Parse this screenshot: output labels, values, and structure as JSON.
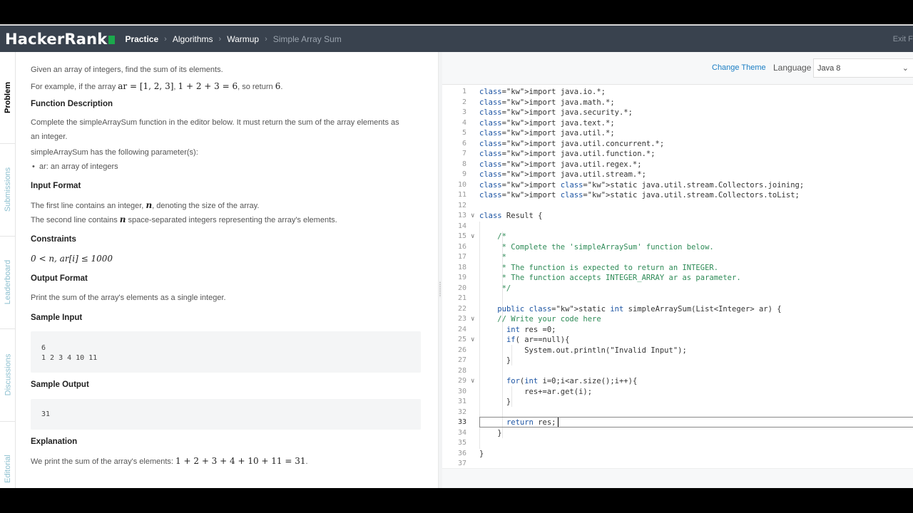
{
  "nav": {
    "logo": "HackerRank",
    "crumbs": [
      "Practice",
      "Algorithms",
      "Warmup",
      "Simple Array Sum"
    ],
    "exit": "Exit Fu"
  },
  "tabs": [
    "Problem",
    "Submissions",
    "Leaderboard",
    "Discussions",
    "Editorial"
  ],
  "problem": {
    "intro": "Given an array of integers, find the sum of its elements.",
    "example_prefix": "For example, if the array ",
    "example_math1": "ar = [1, 2, 3]",
    "example_mid": ", ",
    "example_math2": "1 + 2 + 3 = 6",
    "example_suffix": ", so return ",
    "example_math3": "6",
    "example_end": ".",
    "function_heading": "Function Description",
    "function_desc": "Complete the simpleArraySum function in the editor below. It must return the sum of the array elements as an integer.",
    "params_intro": "simpleArraySum has the following parameter(s):",
    "param1": "ar: an array of integers",
    "input_heading": "Input Format",
    "input_line1_a": "The first line contains an integer, ",
    "input_line1_math": "n",
    "input_line1_b": ", denoting the size of the array.",
    "input_line2_a": "The second line contains ",
    "input_line2_math": "n",
    "input_line2_b": " space-separated integers representing the array's elements.",
    "constraints_heading": "Constraints",
    "constraint": "0 < n, ar[i] ≤ 1000",
    "output_heading": "Output Format",
    "output_desc": "Print the sum of the array's elements as a single integer.",
    "sample_input_heading": "Sample Input",
    "sample_input_l1": "6",
    "sample_input_l2": "1 2 3 4 10 11",
    "sample_output_heading": "Sample Output",
    "sample_output": "31",
    "explanation_heading": "Explanation",
    "explanation_a": "We print the sum of the array's elements: ",
    "explanation_math": "1 + 2 + 3 + 4 + 10 + 11 = 31",
    "explanation_b": "."
  },
  "editor": {
    "change_theme": "Change Theme",
    "language_label": "Language",
    "language_value": "Java 8",
    "current_line": 33,
    "lines": [
      "import java.io.*;",
      "import java.math.*;",
      "import java.security.*;",
      "import java.text.*;",
      "import java.util.*;",
      "import java.util.concurrent.*;",
      "import java.util.function.*;",
      "import java.util.regex.*;",
      "import java.util.stream.*;",
      "import static java.util.stream.Collectors.joining;",
      "import static java.util.stream.Collectors.toList;",
      "",
      "class Result {",
      "",
      "    /*",
      "     * Complete the 'simpleArraySum' function below.",
      "     *",
      "     * The function is expected to return an INTEGER.",
      "     * The function accepts INTEGER_ARRAY ar as parameter.",
      "     */",
      "",
      "    public static int simpleArraySum(List<Integer> ar) {",
      "    // Write your code here",
      "      int res =0;",
      "      if( ar==null){",
      "          System.out.println(\"Invalid Input\");",
      "      }",
      "",
      "      for(int i=0;i<ar.size();i++){",
      "          res+=ar.get(i);",
      "      }",
      "",
      "      return res;",
      "    }",
      "",
      "}",
      ""
    ],
    "fold_lines": [
      13,
      15,
      23,
      25,
      29
    ]
  }
}
